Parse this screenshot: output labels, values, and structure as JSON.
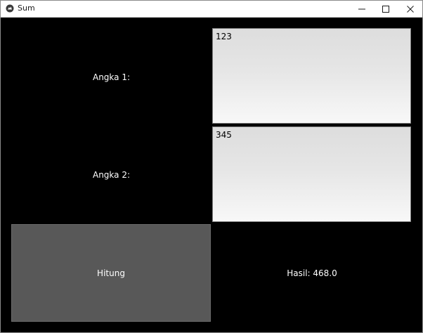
{
  "window": {
    "title": "Sum",
    "app_icon": "kivy-icon",
    "controls": [
      "minimize-icon",
      "maximize-icon",
      "close-icon"
    ]
  },
  "form": {
    "label_1": "Angka 1:",
    "input_1_value": "123",
    "label_2": "Angka 2:",
    "input_2_value": "345",
    "button_label": "Hitung",
    "result_text": "Hasil: 468.0"
  },
  "colors": {
    "background": "#000000",
    "button": "#585858",
    "text": "#ffffff"
  }
}
